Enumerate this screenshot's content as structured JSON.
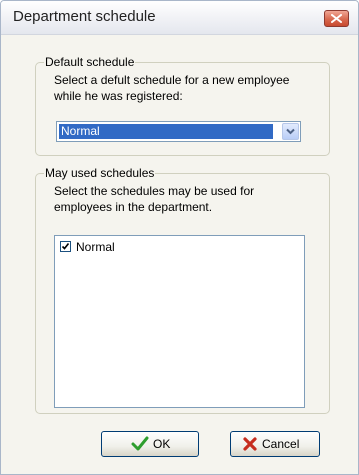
{
  "window": {
    "title": "Department schedule"
  },
  "default_schedule": {
    "legend": "Default schedule",
    "description": "Select a defult schedule for a new employee while he was registered:",
    "selected_value": "Normal"
  },
  "may_used": {
    "legend": "May used schedules",
    "description": "Select the schedules may be used for employees in the department.",
    "items": [
      {
        "label": "Normal",
        "checked": true
      }
    ]
  },
  "buttons": {
    "ok_label": "OK",
    "cancel_label": "Cancel"
  },
  "colors": {
    "selection": "#316ac5",
    "ok_icon": "#2e9e2e",
    "cancel_icon": "#c62d1f",
    "close_button": "#d8694f"
  },
  "icons": {
    "close": "close-icon",
    "dropdown": "chevron-down-icon",
    "ok": "checkmark-icon",
    "cancel": "x-icon"
  }
}
